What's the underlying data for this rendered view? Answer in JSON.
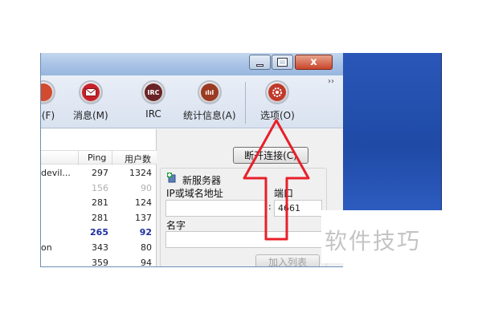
{
  "window": {
    "close_glyph": "x"
  },
  "toolbar": {
    "items": [
      {
        "label": "件(F)",
        "icon": "file-icon",
        "color": "#d24a2f"
      },
      {
        "label": "消息(M)",
        "icon": "envelope-icon",
        "color": "#c8202a"
      },
      {
        "label": "IRC",
        "icon": "irc-icon",
        "icon_text": "IRC",
        "color": "#6a2427"
      },
      {
        "label": "统计信息(A)",
        "icon": "chart-icon",
        "icon_text": "ılıl",
        "color": "#9b3a22"
      },
      {
        "label": "选项(O)",
        "icon": "gear-icon",
        "color": "#c0392b"
      }
    ],
    "more": "››"
  },
  "server_list": {
    "columns": [
      "Ping",
      "用户数"
    ],
    "rows": [
      {
        "name": "devil...",
        "ping": "297",
        "users": "1324",
        "style": ""
      },
      {
        "name": "",
        "ping": "156",
        "users": "90",
        "style": "dim"
      },
      {
        "name": "",
        "ping": "281",
        "users": "124",
        "style": ""
      },
      {
        "name": "",
        "ping": "281",
        "users": "137",
        "style": ""
      },
      {
        "name": "",
        "ping": "265",
        "users": "92",
        "style": "hl"
      },
      {
        "name": "on",
        "ping": "343",
        "users": "80",
        "style": ""
      },
      {
        "name": "",
        "ping": "359",
        "users": "94",
        "style": ""
      }
    ]
  },
  "right": {
    "disconnect_button": "断开连接(C)",
    "new_server": "新服务器",
    "ip_label": "IP或域名地址",
    "port_label": "端口",
    "port_value": "4661",
    "port_sep": ":",
    "name_label": "名字",
    "add_button": "加入列表"
  },
  "watermark": "软件技巧",
  "colors": {
    "arrow": "#e8202a",
    "accent": "#1c2fa0"
  }
}
